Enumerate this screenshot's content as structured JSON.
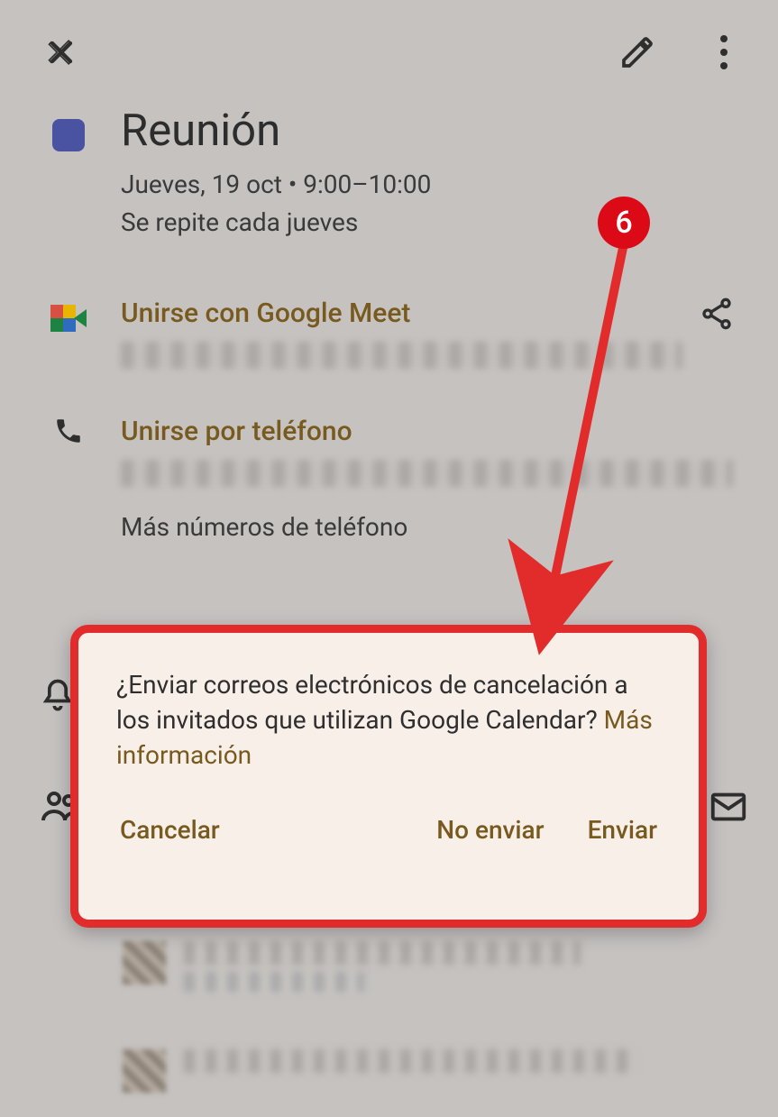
{
  "callout": {
    "number": "6"
  },
  "topbar": {},
  "event": {
    "title": "Reunión",
    "datetime": "Jueves, 19 oct  •  9:00–10:00",
    "recurrence": "Se repite cada jueves"
  },
  "meet": {
    "label": "Unirse con Google Meet"
  },
  "phone": {
    "label": "Unirse por teléfono",
    "more": "Más números de teléfono"
  },
  "dialog": {
    "question": "¿Enviar correos electrónicos de cancelación a los invitados que utilizan Google Calendar? ",
    "more_info": "Más información",
    "cancel": "Cancelar",
    "no_send": "No enviar",
    "send": "Enviar"
  }
}
